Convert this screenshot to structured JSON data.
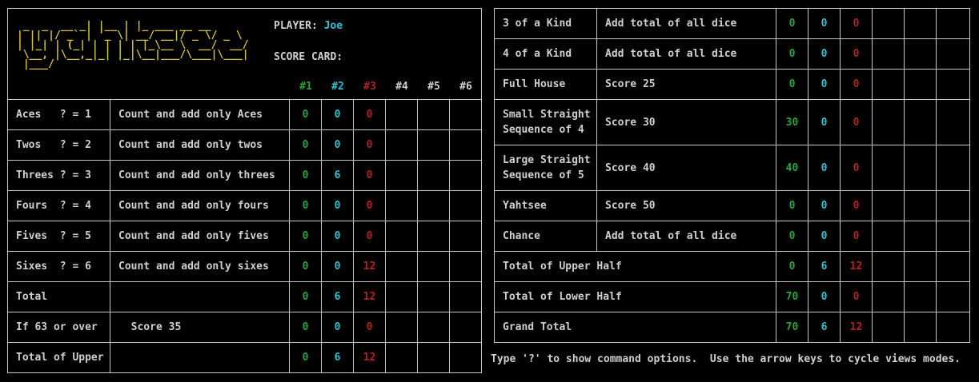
{
  "player": {
    "label": "PLAYER:",
    "name": "Joe"
  },
  "score_card_label": "SCORE CARD:",
  "logo_art": " _  _  __ _| |__ | |_ ___ __ __\n| || |/ _` | '_ \\| __/ __|/ _ \\/ _ \\\n| |_| | (_| | | | | |_\\__ \\  __/  __/\n \\__, |\\__,_|_| |_|\\__|___/\\___|\\___|\n |___/",
  "columns": [
    "#1",
    "#2",
    "#3",
    "#4",
    "#5",
    "#6"
  ],
  "colors": {
    "green": "#27a537",
    "cyan": "#2fc3d2",
    "red": "#b42222",
    "gold": "#d6c436",
    "text": "#cfcfcf",
    "background": "#000000"
  },
  "upper_rows": [
    {
      "name": "Aces   ? = 1",
      "desc": "Count and add only Aces",
      "scores": [
        "0",
        "0",
        "0",
        "",
        "",
        ""
      ]
    },
    {
      "name": "Twos   ? = 2",
      "desc": "Count and add only twos",
      "scores": [
        "0",
        "0",
        "0",
        "",
        "",
        ""
      ]
    },
    {
      "name": "Threes ? = 3",
      "desc": "Count and add only threes",
      "scores": [
        "0",
        "6",
        "0",
        "",
        "",
        ""
      ]
    },
    {
      "name": "Fours  ? = 4",
      "desc": "Count and add only fours",
      "scores": [
        "0",
        "0",
        "0",
        "",
        "",
        ""
      ]
    },
    {
      "name": "Fives  ? = 5",
      "desc": "Count and add only fives",
      "scores": [
        "0",
        "0",
        "0",
        "",
        "",
        ""
      ]
    },
    {
      "name": "Sixes  ? = 6",
      "desc": "Count and add only sixes",
      "scores": [
        "0",
        "0",
        "12",
        "",
        "",
        ""
      ]
    },
    {
      "name": "Total",
      "desc": "",
      "scores": [
        "0",
        "6",
        "12",
        "",
        "",
        ""
      ]
    },
    {
      "name": "If 63 or over",
      "desc": "  Score 35",
      "scores": [
        "0",
        "0",
        "0",
        "",
        "",
        ""
      ]
    },
    {
      "name": "Total of Upper Half",
      "desc": "",
      "scores": [
        "0",
        "6",
        "12",
        "",
        "",
        ""
      ]
    }
  ],
  "lower_rows": [
    {
      "name": "3 of a Kind",
      "name2": "",
      "desc": "Add total of all dice",
      "scores": [
        "0",
        "0",
        "0",
        "",
        "",
        ""
      ]
    },
    {
      "name": "4 of a Kind",
      "name2": "",
      "desc": "Add total of all dice",
      "scores": [
        "0",
        "0",
        "0",
        "",
        "",
        ""
      ]
    },
    {
      "name": "Full House",
      "name2": "",
      "desc": "Score 25",
      "scores": [
        "0",
        "0",
        "0",
        "",
        "",
        ""
      ]
    },
    {
      "name": "Small Straight",
      "name2": "Sequence of 4",
      "desc": "Score 30",
      "scores": [
        "30",
        "0",
        "0",
        "",
        "",
        ""
      ]
    },
    {
      "name": "Large Straight",
      "name2": "Sequence of 5",
      "desc": "Score 40",
      "scores": [
        "40",
        "0",
        "0",
        "",
        "",
        ""
      ]
    },
    {
      "name": "Yahtsee",
      "name2": "",
      "desc": "Score 50",
      "scores": [
        "0",
        "0",
        "0",
        "",
        "",
        ""
      ]
    },
    {
      "name": "Chance",
      "name2": "",
      "desc": "Add total of all dice",
      "scores": [
        "0",
        "0",
        "0",
        "",
        "",
        ""
      ]
    }
  ],
  "lower_totals": [
    {
      "name": "Total of Upper Half",
      "scores": [
        "0",
        "6",
        "12",
        "",
        "",
        ""
      ]
    },
    {
      "name": "Total of Lower Half",
      "scores": [
        "70",
        "0",
        "0",
        "",
        "",
        ""
      ]
    },
    {
      "name": "Grand Total",
      "scores": [
        "70",
        "6",
        "12",
        "",
        "",
        ""
      ]
    }
  ],
  "status_line": "Type '?' to show command options.  Use the arrow keys to cycle views modes."
}
